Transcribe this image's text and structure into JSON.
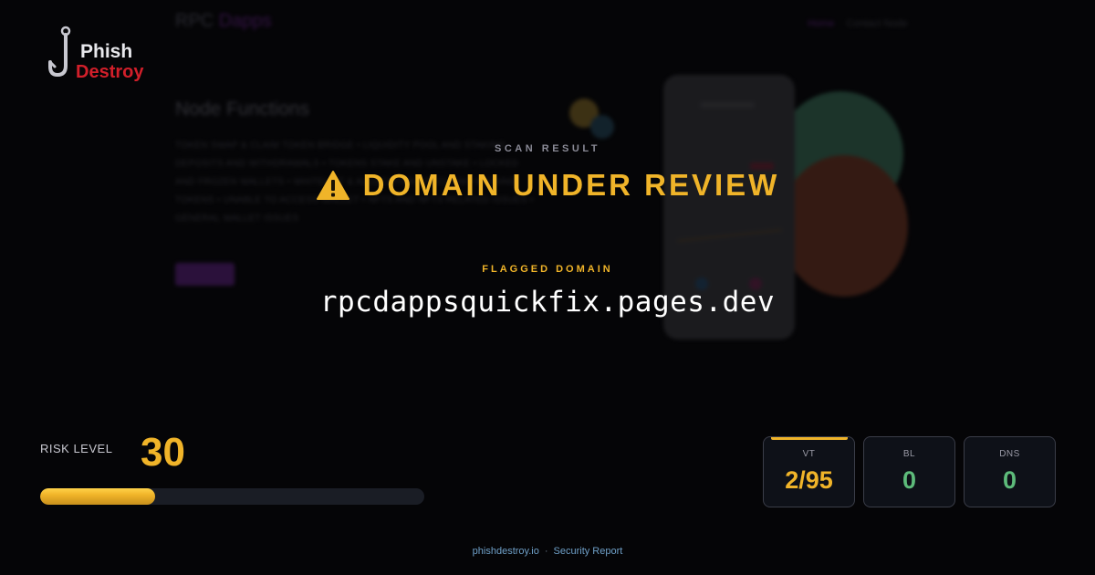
{
  "background": {
    "brand_prefix": "RPC",
    "brand_accent": "Dapps",
    "nav": [
      "Home",
      "Contact Node"
    ],
    "section_title": "Node Functions",
    "section_body": "TOKEN SWAP & CLAIM TOKEN BRIDGE • LIQUIDITY POOL AND STAKING DEPOSITS AND WITHDRAWALS • TOKENS STAKE AND UNSTAKE • LOCKED AND FROZEN WALLETS • WHITELIST & ALLOCATION • RECLAIM • MISSING TOKENS • UNABLE TO ACCESS WALLET • NFTS AND NFTS RELATED ISSUES • GENERAL WALLET ISSUES"
  },
  "logo": {
    "word1": "Phish",
    "word2": "Destroy"
  },
  "scan": {
    "label": "SCAN RESULT",
    "status": "DOMAIN UNDER REVIEW",
    "icon": "warning-icon",
    "flagged_label": "FLAGGED DOMAIN",
    "domain": "rpcdappsquickfix.pages.dev"
  },
  "risk": {
    "label": "RISK LEVEL",
    "value": "30",
    "percent": 30
  },
  "stats": [
    {
      "label": "VT",
      "value": "2/95",
      "color": "#f0b429"
    },
    {
      "label": "BL",
      "value": "0",
      "color": "#5dbb7a"
    },
    {
      "label": "DNS",
      "value": "0",
      "color": "#5dbb7a"
    }
  ],
  "footer": {
    "site": "phishdestroy.io",
    "separator": "·",
    "text": "Security Report"
  },
  "colors": {
    "accent": "#f0b429",
    "safe": "#5dbb7a",
    "brand_red": "#d21f2a",
    "background": "#050507"
  }
}
